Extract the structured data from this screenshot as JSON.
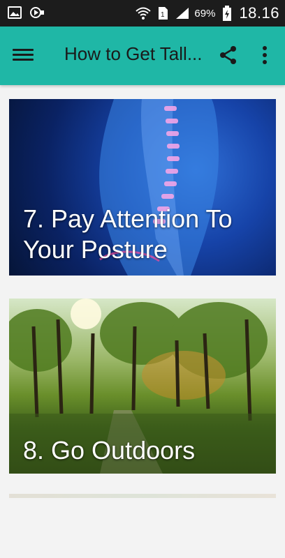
{
  "status_bar": {
    "left_icons": [
      "image-icon",
      "video-icon"
    ],
    "battery_percent": "69%",
    "time": "18.16"
  },
  "app_bar": {
    "title": "How to Get Tall..."
  },
  "cards": [
    {
      "caption": "7. Pay Attention To Your Posture",
      "image": "spine-posture-image"
    },
    {
      "caption": "8. Go Outdoors",
      "image": "forest-sunlight-image"
    }
  ],
  "colors": {
    "app_bar": "#1fb7a6",
    "status_bar": "#1c1c1c",
    "background": "#f3f3f3"
  }
}
